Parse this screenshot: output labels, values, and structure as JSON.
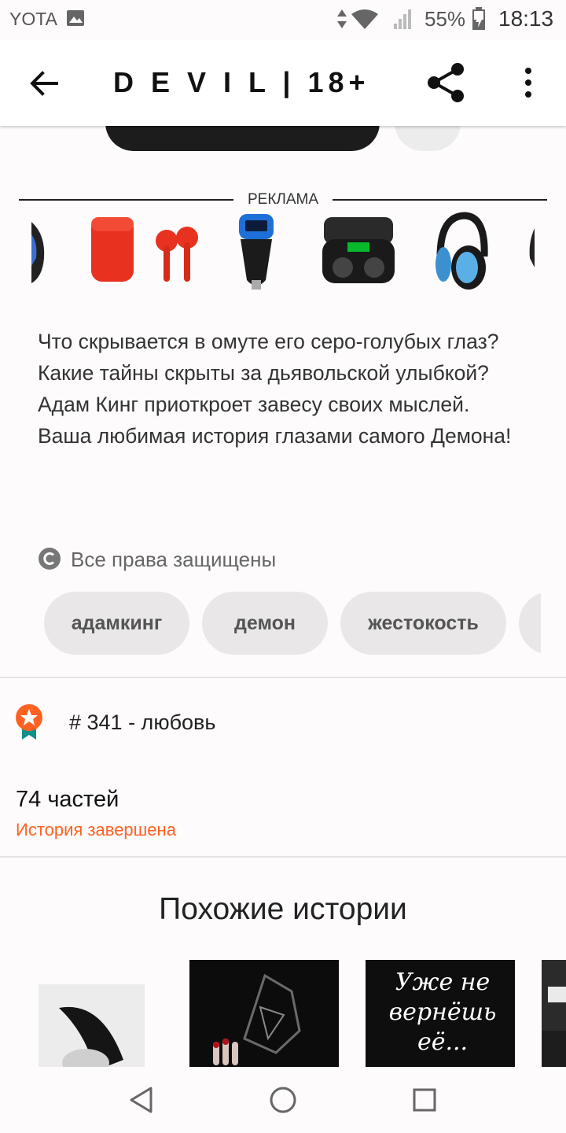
{
  "status_bar": {
    "carrier": "YOTA",
    "battery": "55%",
    "time": "18:13"
  },
  "app_bar": {
    "title": "D E V I L | 18+"
  },
  "ad": {
    "label": "РЕКЛАМА",
    "items": [
      "phone-icon",
      "red-earbuds",
      "car-charger",
      "earbuds-case",
      "blue-headphones",
      "headphones"
    ]
  },
  "description": {
    "lines": [
      "Что скрывается в омуте его серо-голубых глаз?",
      "Какие тайны скрыты за дьявольской улыбкой?",
      "Адам Кинг приоткроет завесу своих мыслей.",
      "Ваша любимая история глазами самого Демона!"
    ]
  },
  "copyright": "Все права защищены",
  "tags": [
    "адамкинг",
    "демон",
    "жестокость"
  ],
  "ranking": "# 341 - любовь",
  "parts": "74 частей",
  "story_status": "История завершена",
  "similar": {
    "title": "Похожие истории",
    "covers": [
      {
        "text": ""
      },
      {
        "text": ""
      },
      {
        "text": "Уже не вернёшь её..."
      },
      {
        "text": ""
      }
    ]
  },
  "colors": {
    "accent": "#ff6122",
    "read_button": "#1c1c1c",
    "tag_bg": "#e9e7e7"
  }
}
